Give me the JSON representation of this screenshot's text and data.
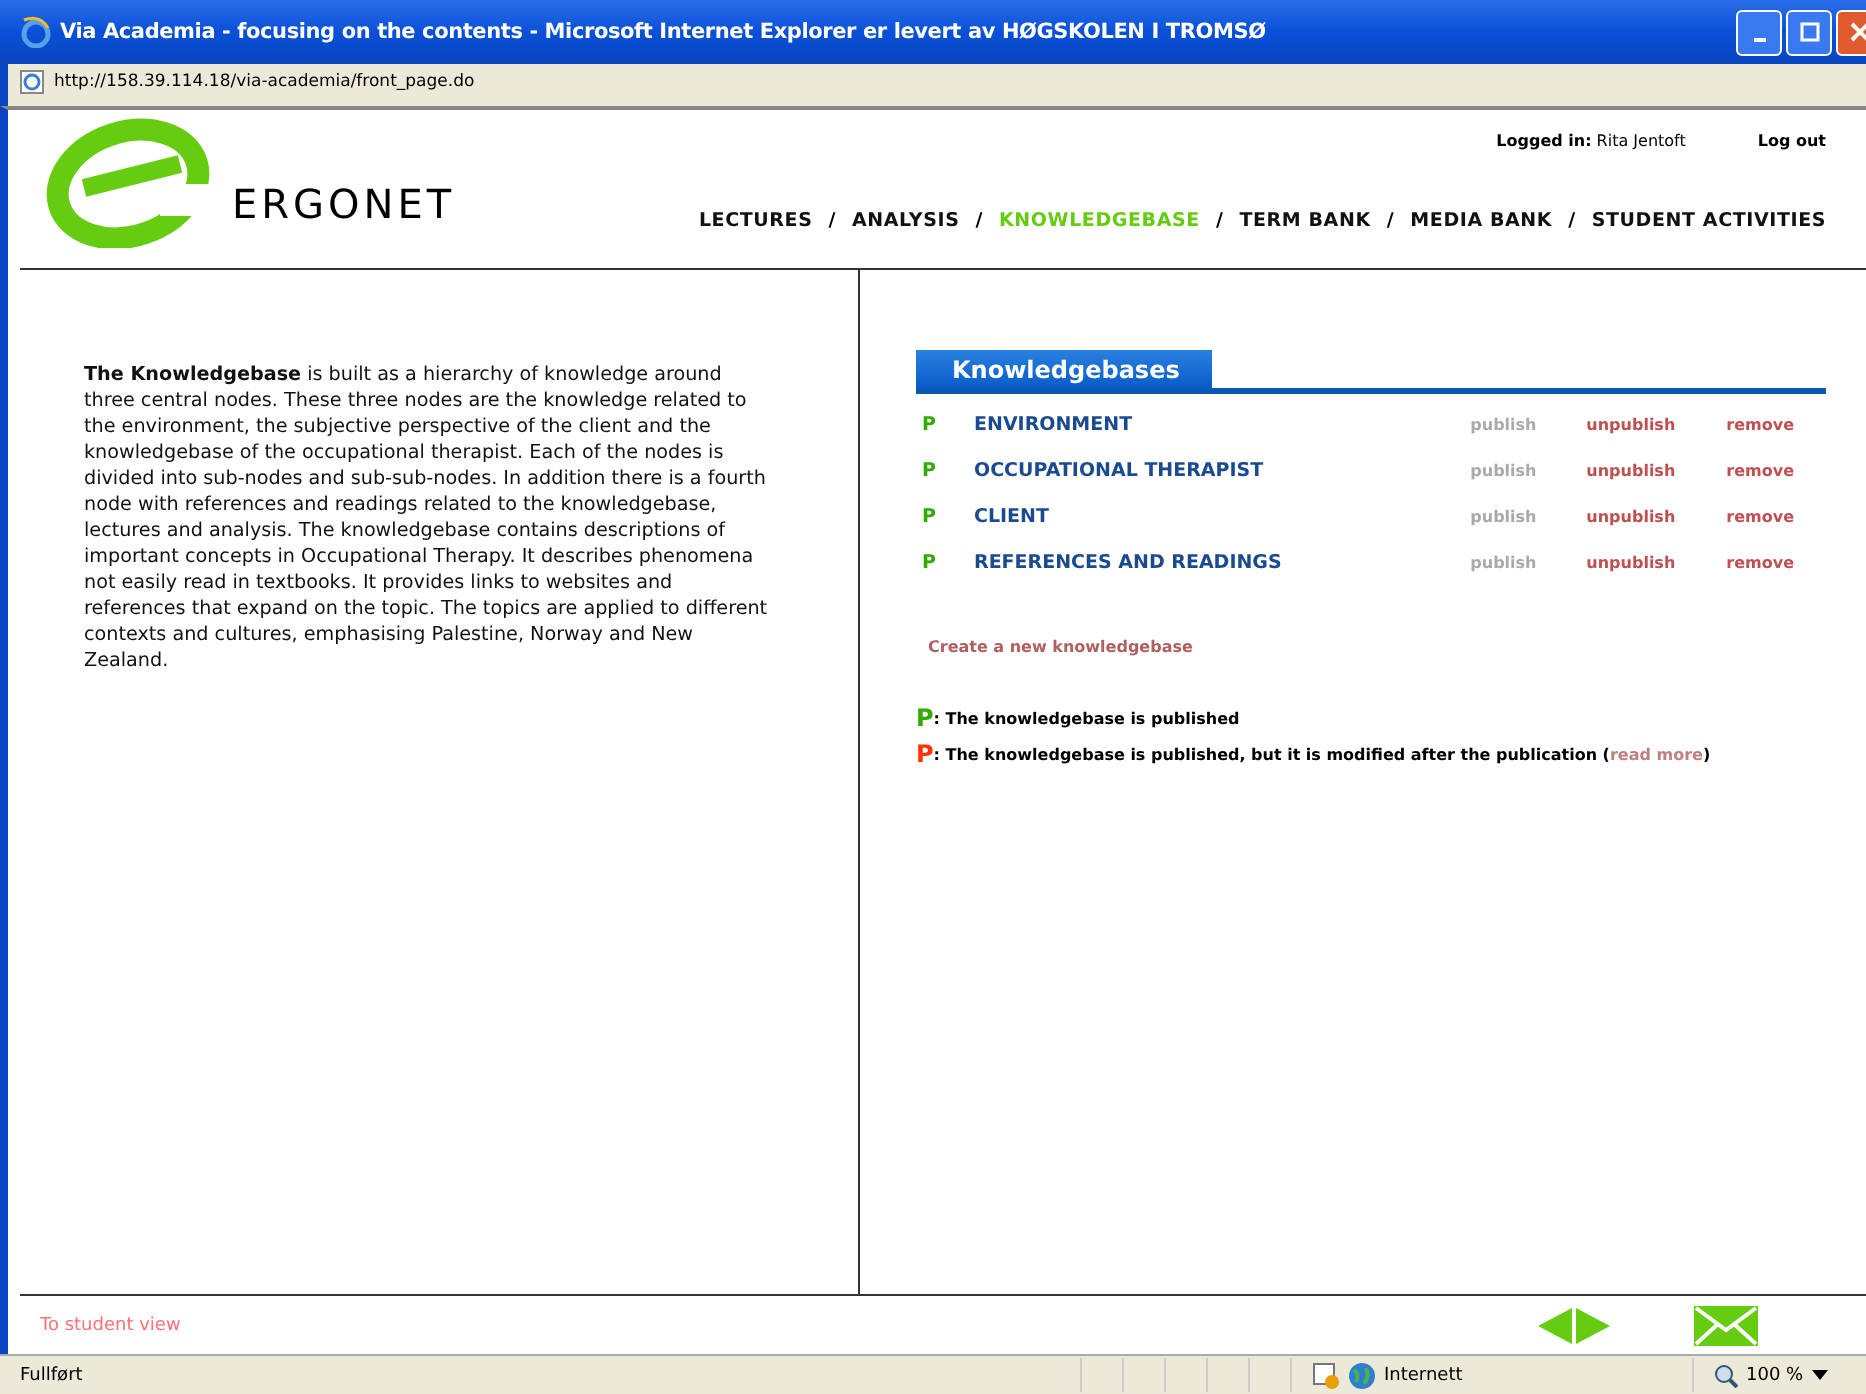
{
  "window": {
    "title": "Via Academia - focusing on the contents - Microsoft Internet Explorer er levert av HØGSKOLEN I TROMSØ",
    "address": "http://158.39.114.18/via-academia/front_page.do"
  },
  "header": {
    "logo_text": "ERGONET",
    "logged_in_label": "Logged in:",
    "user": "Rita Jentoft",
    "logout": "Log out"
  },
  "nav": [
    {
      "label": "LECTURES",
      "selected": false
    },
    {
      "label": "ANALYSIS",
      "selected": false
    },
    {
      "label": "KNOWLEDGEBASE",
      "selected": true
    },
    {
      "label": "TERM BANK",
      "selected": false
    },
    {
      "label": "MEDIA BANK",
      "selected": false
    },
    {
      "label": "STUDENT ACTIVITIES",
      "selected": false
    }
  ],
  "nav_separator": "/",
  "intro": "**The Knowledgebase** is built as a hierarchy of knowledge around three central nodes. These three nodes are the knowledge related to the environment, the subjective perspective of the client and the knowledgebase of the occupational therapist. Each of the nodes is divided into sub-nodes and sub-sub-nodes. In addition there is a fourth node with references and readings related to the knowledgebase, lectures and analysis. The knowledgebase contains descriptions of important concepts in Occupational Therapy. It describes phenomena not easily read in textbooks. It provides links to websites and references that expand on the topic. The topics are applied to different contexts and cultures, emphasising Palestine, Norway and New Zealand.",
  "knowledgebases": {
    "tab": "Knowledgebases",
    "rows": [
      {
        "status": "P",
        "color": "#33aa00",
        "name": "ENVIRONMENT",
        "actions": [
          "publish",
          "unpublish",
          "remove"
        ]
      },
      {
        "status": "P",
        "color": "#33aa00",
        "name": "OCCUPATIONAL THERAPIST",
        "actions": [
          "publish",
          "unpublish",
          "remove"
        ]
      },
      {
        "status": "P",
        "color": "#33aa00",
        "name": "CLIENT",
        "actions": [
          "publish",
          "unpublish",
          "remove"
        ]
      },
      {
        "status": "P",
        "color": "#33aa00",
        "name": "REFERENCES AND READINGS",
        "actions": [
          "publish",
          "unpublish",
          "remove"
        ]
      }
    ],
    "create": "Create a new knowledgebase",
    "legend": [
      {
        "status": "P",
        "color": "#33aa00",
        "text": ": The knowledgebase is published"
      },
      {
        "status": "P",
        "color": "#ff3300",
        "text": ": The knowledgebase is published, but it is modified after the publication (",
        "link": "read more",
        "after": ")"
      }
    ]
  },
  "footer": {
    "student_view": "To student view"
  },
  "status_bar": {
    "text": "Fullført",
    "zone": "Internett",
    "zoom": "100 %"
  }
}
